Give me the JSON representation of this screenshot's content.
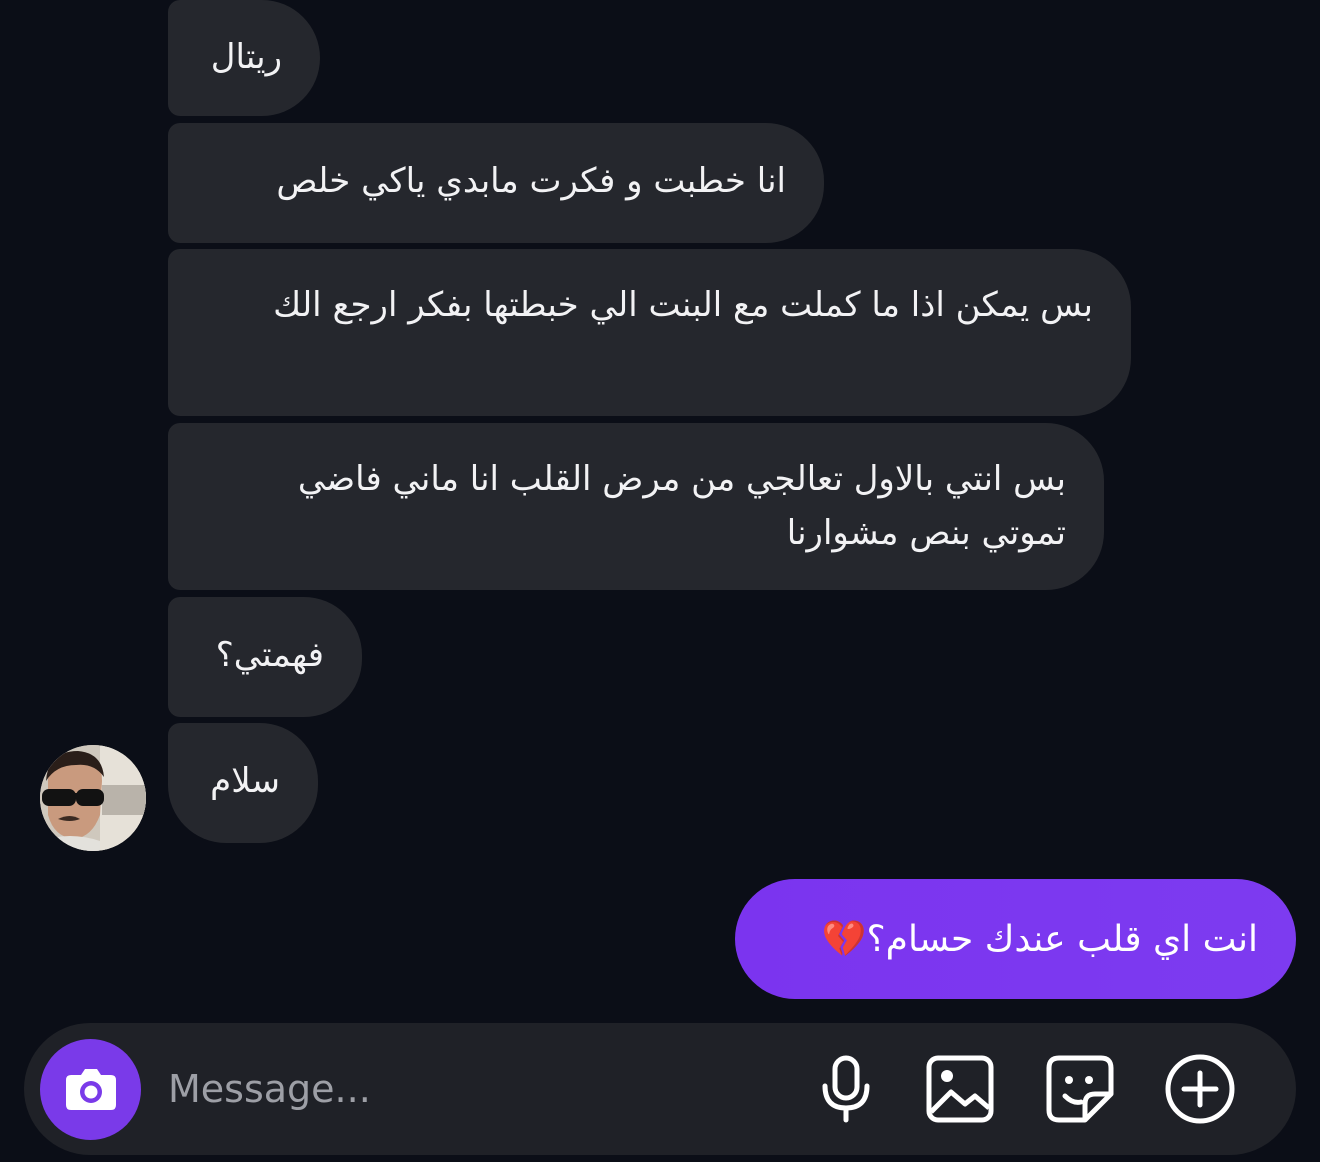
{
  "messages_received": [
    {
      "text": "ريتال"
    },
    {
      "text": "انا خطبت و فكرت مابدي ياكي خلص"
    },
    {
      "text": "بس يمكن اذا ما كملت مع البنت الي خبطتها بفكر ارجع الك"
    },
    {
      "text": "بس انتي بالاول تعالجي من مرض القلب انا ماني فاضي تموتي بنص مشوارنا"
    },
    {
      "text": "فهمتي؟"
    },
    {
      "text": "سلام"
    }
  ],
  "message_sent": {
    "text": "انت اي قلب عندك حسام؟💔"
  },
  "composer": {
    "placeholder": "Message...",
    "icons": [
      "camera-icon",
      "microphone-icon",
      "gallery-icon",
      "sticker-icon",
      "plus-icon"
    ]
  },
  "colors": {
    "background": "#0b0e17",
    "received_bubble": "#25272d",
    "sent_bubble": "#7b34ef",
    "composer": "#1f2127",
    "accent": "#7a3ae9"
  }
}
